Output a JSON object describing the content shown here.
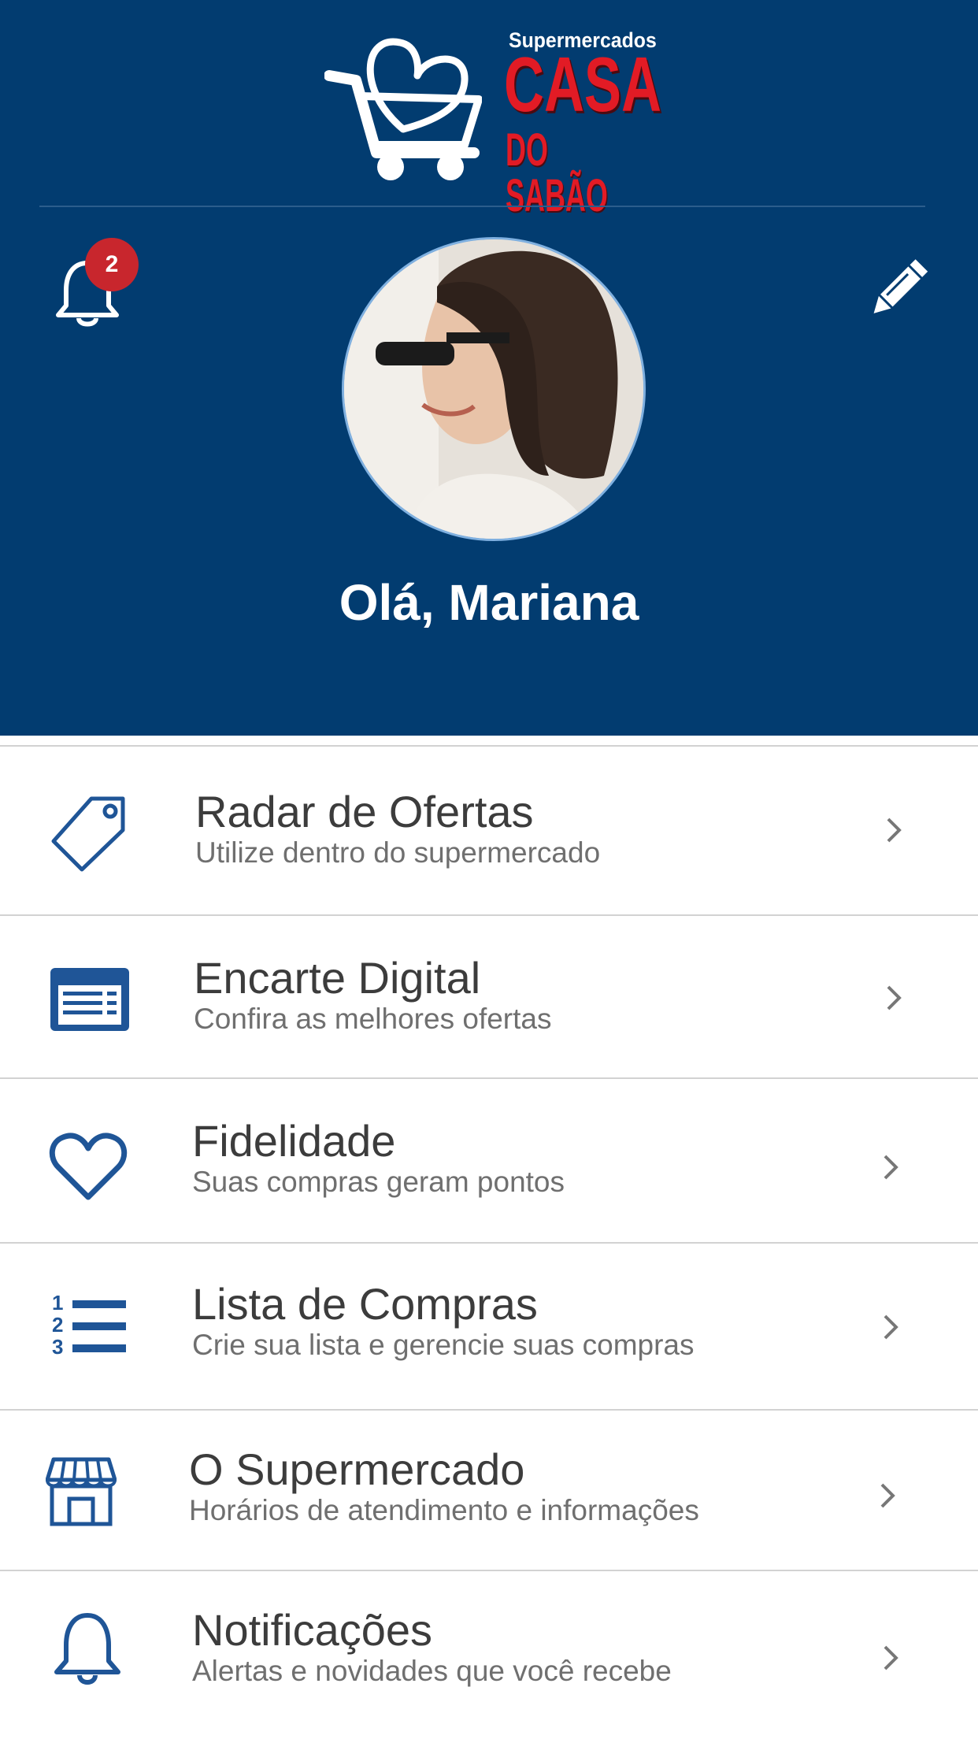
{
  "brand": {
    "line1": "Supermercados",
    "line2": "CASA",
    "line3": "DO SABÃO"
  },
  "header": {
    "notification_count": "2",
    "greeting": "Olá, Mariana"
  },
  "menu": [
    {
      "title": "Radar de Ofertas",
      "subtitle": "Utilize dentro do supermercado",
      "icon": "tag-icon"
    },
    {
      "title": "Encarte Digital",
      "subtitle": "Confira as melhores ofertas",
      "icon": "flyer-icon"
    },
    {
      "title": "Fidelidade",
      "subtitle": "Suas compras geram pontos",
      "icon": "heart-icon"
    },
    {
      "title": "Lista de Compras",
      "subtitle": "Crie sua lista e gerencie suas compras",
      "icon": "numbered-list-icon"
    },
    {
      "title": "O Supermercado",
      "subtitle": "Horários de atendimento e informações",
      "icon": "store-icon"
    },
    {
      "title": "Notificações",
      "subtitle": "Alertas e novidades que você recebe",
      "icon": "bell-icon"
    }
  ],
  "colors": {
    "header_bg": "#023c70",
    "icon_blue": "#1f5597",
    "badge_red": "#c8262d",
    "brand_red": "#e21b25"
  }
}
